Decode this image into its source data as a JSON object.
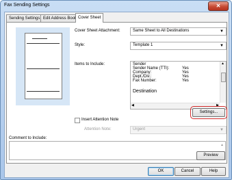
{
  "window": {
    "title": "Fax Sending Settings",
    "close_glyph": "✕"
  },
  "tabs": [
    {
      "label": "Sending Settings"
    },
    {
      "label": "Edit Address Book"
    },
    {
      "label": "Cover Sheet"
    }
  ],
  "cover_sheet_attachment": {
    "label": "Cover Sheet Attachment:",
    "value": "Same Sheet to All Destinations"
  },
  "style": {
    "label": "Style:",
    "value": "Template 1"
  },
  "items_to_include": {
    "label": "Items to Include:",
    "rows": [
      {
        "key": "Sender",
        "value": ""
      },
      {
        "key": "Sender Name (TTI):",
        "value": "Yes"
      },
      {
        "key": "Company:",
        "value": "Yes"
      },
      {
        "key": "Dept./Div.:",
        "value": "Yes"
      },
      {
        "key": "Fax Number:",
        "value": "Yes"
      },
      {
        "key": "Destination",
        "value": ""
      }
    ]
  },
  "settings_button": "Settings...",
  "insert_attention_note": {
    "label": "Insert Attention Note",
    "checked": false
  },
  "attention_note": {
    "label": "Attention Note:",
    "value": "Urgent"
  },
  "comment": {
    "label": "Comment to Include:",
    "value": ""
  },
  "preview_button": "Preview",
  "footer": {
    "ok": "OK",
    "cancel": "Cancel",
    "help": "Help"
  }
}
